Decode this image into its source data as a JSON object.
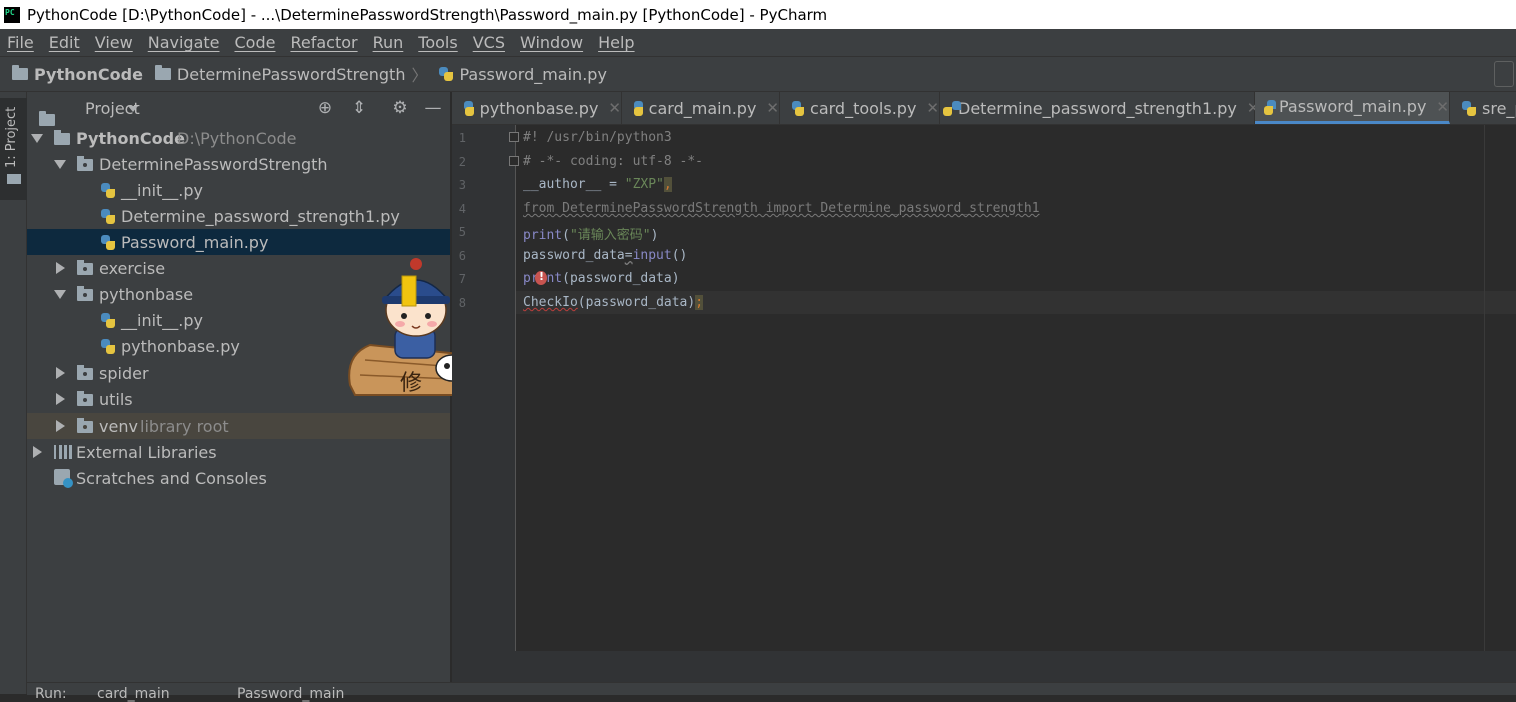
{
  "window": {
    "title": "PythonCode [D:\\PythonCode] - ...\\DeterminePasswordStrength\\Password_main.py [PythonCode] - PyCharm"
  },
  "menu": [
    "File",
    "Edit",
    "View",
    "Navigate",
    "Code",
    "Refactor",
    "Run",
    "Tools",
    "VCS",
    "Window",
    "Help"
  ],
  "breadcrumb": {
    "project": "PythonCode",
    "folder": "DeterminePasswordStrength",
    "file": "Password_main.py"
  },
  "tool_stripe": {
    "project_label": "1: Project"
  },
  "project_panel": {
    "title": "Project",
    "tree": [
      {
        "label": "PythonCode",
        "extra": "D:\\PythonCode"
      },
      {
        "label": "DeterminePasswordStrength"
      },
      {
        "label": "__init__.py"
      },
      {
        "label": "Determine_password_strength1.py"
      },
      {
        "label": "Password_main.py"
      },
      {
        "label": "exercise"
      },
      {
        "label": "pythonbase"
      },
      {
        "label": "__init__.py"
      },
      {
        "label": "pythonbase.py"
      },
      {
        "label": "spider"
      },
      {
        "label": "utils"
      },
      {
        "label": "venv",
        "extra": "library root"
      },
      {
        "label": "External Libraries"
      },
      {
        "label": "Scratches and Consoles"
      }
    ]
  },
  "tabs": [
    {
      "label": "pythonbase.py"
    },
    {
      "label": "card_main.py"
    },
    {
      "label": "card_tools.py"
    },
    {
      "label": "Determine_password_strength1.py"
    },
    {
      "label": "Password_main.py",
      "active": true
    },
    {
      "label": "sre_p"
    }
  ],
  "editor": {
    "line_numbers": [
      "1",
      "2",
      "3",
      "4",
      "5",
      "6",
      "7",
      "8"
    ],
    "lines": [
      {
        "shebang": "#! /usr/bin/python3"
      },
      {
        "coding": "# -*- coding: utf-8 -*-"
      },
      {
        "a": "__author__ = ",
        "b": "\"ZXP\"",
        "c": ","
      },
      {
        "text": "from DeterminePasswordStrength import Determine_password_strength1"
      },
      {
        "fn": "print",
        "open": "(",
        "str": "\"请输入密码\"",
        "close": ")"
      },
      {
        "a": "password_data",
        "eq": "=",
        "fn": "input",
        "rest": "()"
      },
      {
        "fn": "print",
        "rest": "(password_data)"
      },
      {
        "err": "CheckIo",
        "rest": "(password_data)",
        "semi": ";"
      }
    ]
  },
  "bottom_tabs": [
    "Run:",
    "card_main",
    "Password_main"
  ],
  "colors": {
    "accent": "#4a88c7",
    "selection": "#0d293e",
    "excluded": "#49463f"
  }
}
